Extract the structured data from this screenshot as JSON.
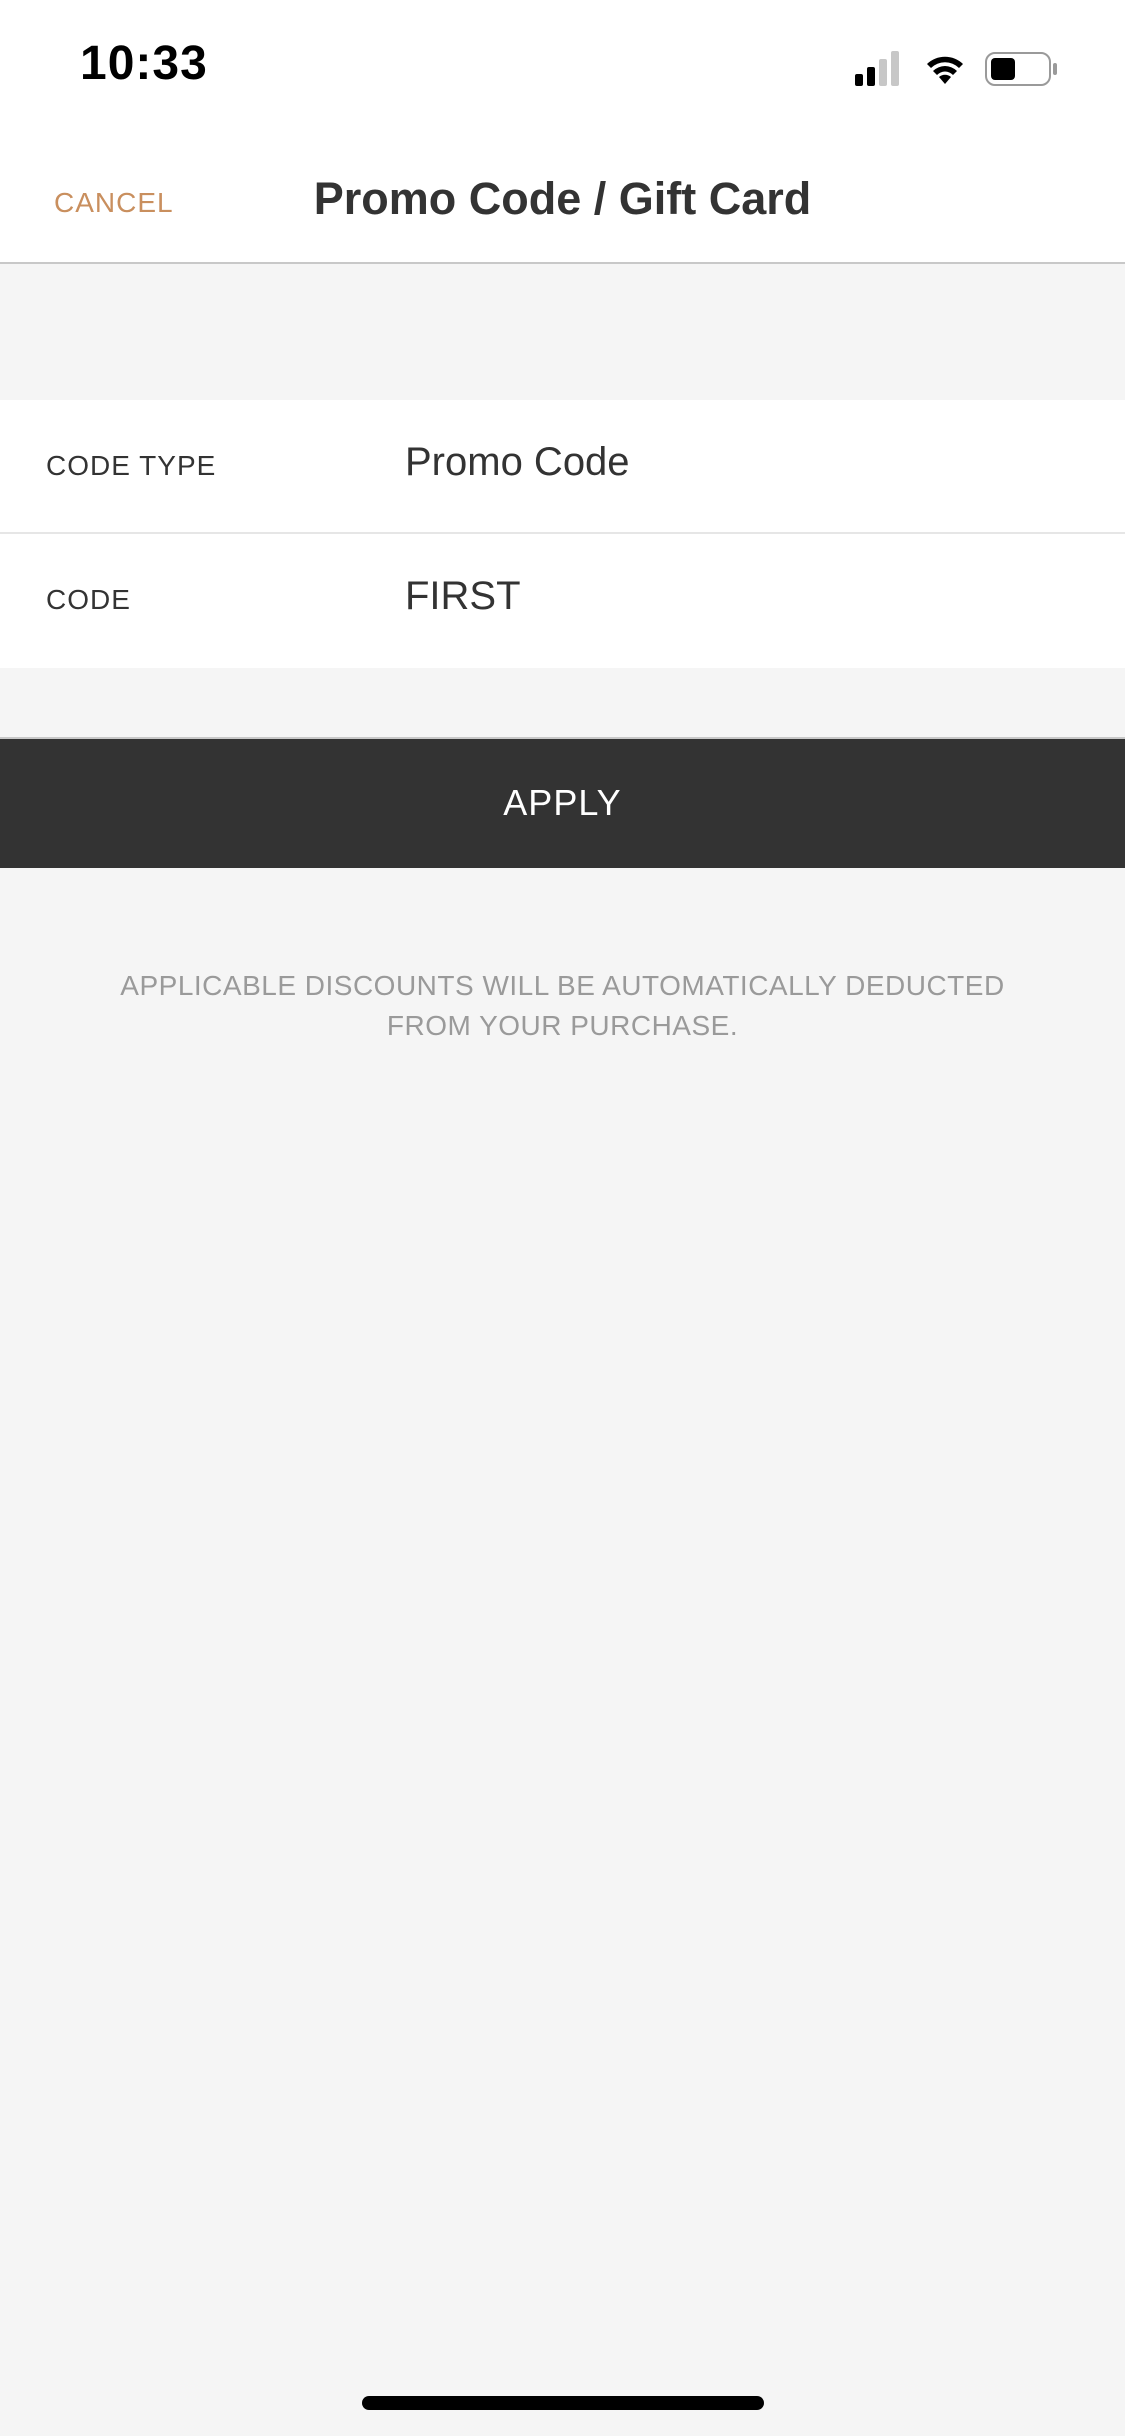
{
  "status_bar": {
    "time": "10:33",
    "icons": [
      "signal-icon",
      "wifi-icon",
      "battery-icon"
    ]
  },
  "nav": {
    "cancel_label": "CANCEL",
    "title": "Promo Code / Gift Card"
  },
  "form": {
    "rows": [
      {
        "label": "CODE TYPE",
        "value": "Promo Code"
      },
      {
        "label": "CODE",
        "value": "FIRST"
      }
    ]
  },
  "apply_label": "APPLY",
  "note": "APPLICABLE DISCOUNTS WILL BE AUTOMATICALLY DEDUCTED FROM YOUR PURCHASE.",
  "colors": {
    "accent": "#c98f5e",
    "button_bg": "#333333",
    "background": "#f5f5f5"
  }
}
